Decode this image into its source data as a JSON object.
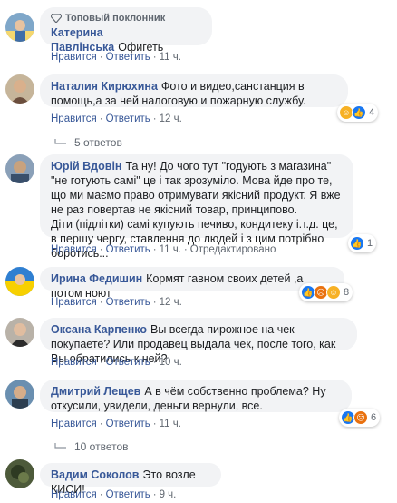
{
  "actions": {
    "like": "Нравится",
    "reply": "Ответить",
    "separator": "·",
    "edited": "Отредактировано"
  },
  "colors": {
    "link": "#385898",
    "bubble": "#f2f3f5",
    "meta": "#606770",
    "like_blue": "#1877f2",
    "love_red": "#f33e58",
    "haha_yellow": "#f7b125"
  },
  "comments": [
    {
      "badge": "Топовый поклонник",
      "author": "Катерина Павлінська",
      "text": "Офигеть",
      "time": "11 ч."
    },
    {
      "author": "Наталия Кирюхина",
      "text": "Фото и видео,санстанция в помощь,а за ней налоговую и пожарную службу.",
      "time": "12 ч.",
      "reactions_count": "4",
      "reaction_icons": [
        "haha-icon",
        "like-icon"
      ]
    },
    {
      "replies": "5 ответов"
    },
    {
      "author": "Юрій Вдовін",
      "text": "Та ну! До чого тут \"годують з магазина\" \"не готують самі\" це і так зрозуміло. Мова йде про те, що ми маємо право отримувати якісний продукт. Я вже не раз повертав не якісний товар, принципово.\nДіти (підлітки) самі купують печиво, кондитеку і.т.д. це, в першу чергу, ставлення до людей і з цим потрібно боротись...",
      "time": "11 ч.",
      "edited": true,
      "reactions_count": "1",
      "reaction_icons": [
        "like-icon"
      ]
    },
    {
      "author": "Ирина Федишин",
      "text": "Кормят гавном своих детей ,а потом ноют",
      "time": "12 ч.",
      "reactions_count": "8",
      "reaction_icons": [
        "like-icon",
        "angry-icon",
        "haha-icon"
      ]
    },
    {
      "author": "Оксана Карпенко",
      "text": "Вы всегда пирожное на чек покупаете? Или продавец выдала чек, после того, как Вы обратились к ней?",
      "time": "10 ч."
    },
    {
      "author": "Дмитрий Лещев",
      "text": "А в чём собственно проблема? Ну откусили, увидели, деньги вернули, все.",
      "time": "11 ч.",
      "reactions_count": "6",
      "reaction_icons": [
        "like-icon",
        "angry-icon"
      ]
    },
    {
      "replies": "10 ответов"
    },
    {
      "author": "Вадим Соколов",
      "text": "Это возле КИСИ!",
      "time": "9 ч."
    }
  ]
}
